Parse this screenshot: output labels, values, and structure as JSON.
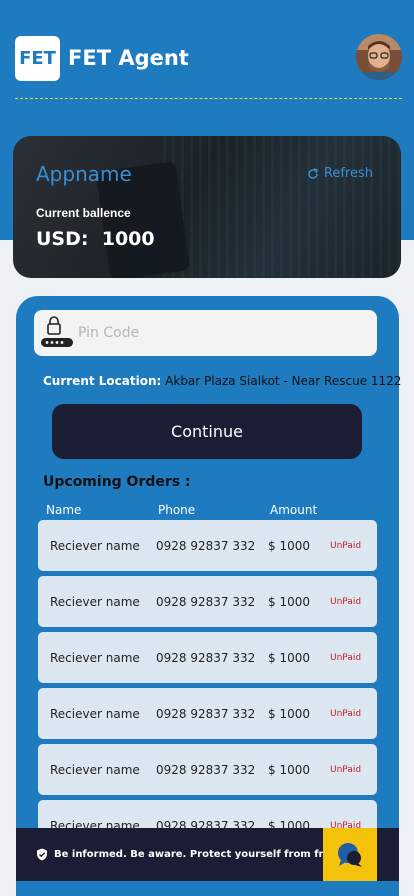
{
  "header": {
    "logo_text": "FET",
    "app_title": "FET Agent"
  },
  "balance_card": {
    "appname": "Appname",
    "refresh_label": "Refresh",
    "balance_label": "Current ballence",
    "currency": "USD:",
    "amount": "1000"
  },
  "pin": {
    "placeholder": "Pin Code",
    "value": ""
  },
  "location": {
    "label": "Current Location:",
    "value": "Akbar Plaza Sialkot - Near Rescue 1122"
  },
  "continue_label": "Continue",
  "orders": {
    "title": "Upcoming Orders :",
    "columns": [
      "Name",
      "Phone",
      "Amount"
    ],
    "rows": [
      {
        "name": "Reciever name",
        "phone": "0928 92837 332",
        "amount": "$ 1000",
        "status": "UnPaid"
      },
      {
        "name": "Reciever name",
        "phone": "0928 92837 332",
        "amount": "$ 1000",
        "status": "UnPaid"
      },
      {
        "name": "Reciever name",
        "phone": "0928 92837 332",
        "amount": "$ 1000",
        "status": "UnPaid"
      },
      {
        "name": "Reciever name",
        "phone": "0928 92837 332",
        "amount": "$ 1000",
        "status": "UnPaid"
      },
      {
        "name": "Reciever name",
        "phone": "0928 92837 332",
        "amount": "$ 1000",
        "status": "UnPaid"
      },
      {
        "name": "Reciever name",
        "phone": "0928 92837 332",
        "amount": "$ 1000",
        "status": "UnPaid"
      }
    ]
  },
  "banner": {
    "text": "Be informed. Be aware. Protect yourself from fraud"
  },
  "colors": {
    "primary": "#1f7bbf",
    "dark": "#1b1d34",
    "accent_yellow": "#f5c20b",
    "unpaid_red": "#c0212b"
  },
  "icons": [
    "refresh-icon",
    "lock-icon",
    "shield-icon",
    "chat-icon"
  ]
}
